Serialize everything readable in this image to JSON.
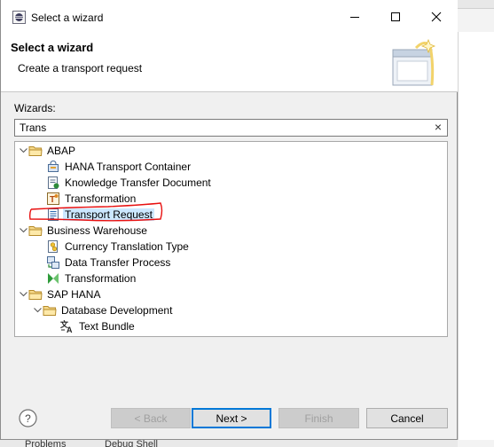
{
  "window": {
    "title": "Select a wizard"
  },
  "header": {
    "title": "Select a wizard",
    "description": "Create a transport request"
  },
  "wizards": {
    "label": "Wizards:",
    "filter_value": "Trans"
  },
  "tree": [
    {
      "label": "ABAP",
      "icon": "folder-icon",
      "expanded": true
    },
    {
      "label": "HANA Transport Container",
      "icon": "hana-transport-container-icon"
    },
    {
      "label": "Knowledge Transfer Document",
      "icon": "knowledge-transfer-document-icon"
    },
    {
      "label": "Transformation",
      "icon": "transformation-icon"
    },
    {
      "label": "Transport Request",
      "icon": "transport-request-icon",
      "selected": true
    },
    {
      "label": "Business Warehouse",
      "icon": "folder-icon",
      "expanded": true
    },
    {
      "label": "Currency Translation Type",
      "icon": "currency-translation-type-icon"
    },
    {
      "label": "Data Transfer Process",
      "icon": "data-transfer-process-icon"
    },
    {
      "label": "Transformation",
      "icon": "bw-transformation-icon"
    },
    {
      "label": "SAP HANA",
      "icon": "folder-icon",
      "expanded": true
    },
    {
      "label": "Database Development",
      "icon": "folder-icon",
      "expanded": true
    },
    {
      "label": "Text Bundle",
      "icon": "text-bundle-icon"
    }
  ],
  "buttons": {
    "back": "< Back",
    "next": "Next >",
    "finish": "Finish",
    "cancel": "Cancel"
  },
  "background": {
    "bottom_tabs": [
      "Problems",
      "Debug Shell"
    ]
  },
  "colors": {
    "selection": "#cce8ff",
    "annotation": "#e81010",
    "default_button_border": "#0078d7"
  }
}
